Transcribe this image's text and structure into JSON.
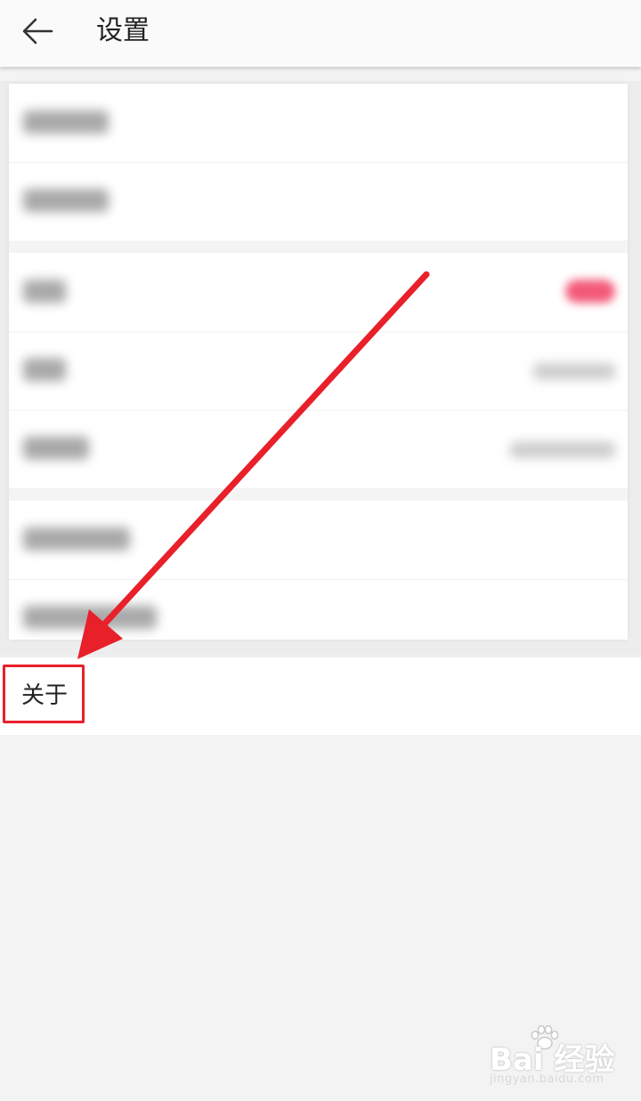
{
  "header": {
    "back_icon": "arrow-left-icon",
    "title": "设置"
  },
  "settings_list": {
    "blurred": true,
    "rows": [
      {
        "kind": "blurred-item"
      },
      {
        "kind": "blurred-item"
      },
      {
        "kind": "blurred-toggle",
        "toggle_color": "#f2486a"
      },
      {
        "kind": "blurred-value"
      },
      {
        "kind": "blurred-value"
      },
      {
        "kind": "blurred-item"
      },
      {
        "kind": "blurred-item"
      }
    ]
  },
  "about": {
    "label": "关于"
  },
  "annotation": {
    "color": "#e8202a",
    "shape": "arrow-and-box"
  },
  "watermark": {
    "main": "Bai 经验",
    "sub": "jingyan.baidu.com"
  }
}
